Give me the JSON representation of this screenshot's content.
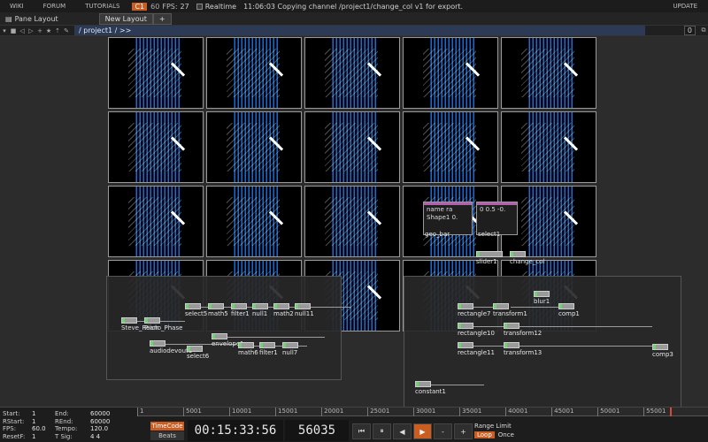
{
  "menubar": {
    "items": [
      "WIKI",
      "FORUM",
      "TUTORIALS"
    ],
    "badge": "C1",
    "badge_num": "60",
    "fps_label": "FPS:",
    "fps_value": "27",
    "realtime_label": "Realtime",
    "status": "11:06:03 Copying channel /project1/change_col v1 for export.",
    "update": "UPDATE"
  },
  "panebar": {
    "pane_layout": "Pane Layout",
    "new_layout": "New Layout",
    "plus": "+"
  },
  "pathbar": {
    "path": "/ project1 / >>",
    "count": "0"
  },
  "grid": {
    "cells": 20
  },
  "nodes_left": [
    {
      "name": "Steve_Reich"
    },
    {
      "name": "Piano_Phase"
    },
    {
      "name": "select5"
    },
    {
      "name": "math5"
    },
    {
      "name": "filter1"
    },
    {
      "name": "null1"
    },
    {
      "name": "math2"
    },
    {
      "name": "null11"
    },
    {
      "name": "envelope1"
    },
    {
      "name": "audiodevout1"
    },
    {
      "name": "select6"
    },
    {
      "name": "math6"
    },
    {
      "name": "filter1"
    },
    {
      "name": "null7"
    }
  ],
  "nodes_right": [
    {
      "name": "blur1"
    },
    {
      "name": "rectangle7"
    },
    {
      "name": "transform1"
    },
    {
      "name": "comp1"
    },
    {
      "name": "rectangle10"
    },
    {
      "name": "transform12"
    },
    {
      "name": "rectangle11"
    },
    {
      "name": "transform13"
    },
    {
      "name": "comp3"
    },
    {
      "name": "constant1"
    }
  ],
  "center_nodes": {
    "geo_bar": "geo_bar",
    "geo_text": "name  ra",
    "geo_sub": "Shape1 0.",
    "select": "select1",
    "select_text": "0 0.5 -0.",
    "slider": "slider1",
    "change_col": "change_col"
  },
  "timeline": {
    "stats": [
      {
        "k": "Start:",
        "v": "1",
        "k2": "End:",
        "v2": "60000"
      },
      {
        "k": "RStart:",
        "v": "1",
        "k2": "REnd:",
        "v2": "60000"
      },
      {
        "k": "FPS:",
        "v": "60.0",
        "k2": "Tempo:",
        "v2": "120.0"
      },
      {
        "k": "ResetF:",
        "v": "1",
        "k2": "T Sig:",
        "v2": "4   4"
      }
    ],
    "ruler_ticks": [
      "1",
      "5001",
      "10001",
      "15001",
      "20001",
      "25001",
      "30001",
      "35001",
      "40001",
      "45001",
      "50001",
      "55001"
    ],
    "playhead_fraction": 0.933,
    "tc_on": "TimeCode",
    "tc_off": "Beats",
    "timecode": "00:15:33:56",
    "frame": "56035",
    "transport": [
      "⏮",
      "⏸",
      "◀",
      "▶",
      "-",
      "+"
    ],
    "range_label": "Range Limit",
    "range_on": "Loop",
    "range_off": "Once"
  },
  "colors": {
    "accent": "#c95d22",
    "blue": "#1f6fd0"
  }
}
